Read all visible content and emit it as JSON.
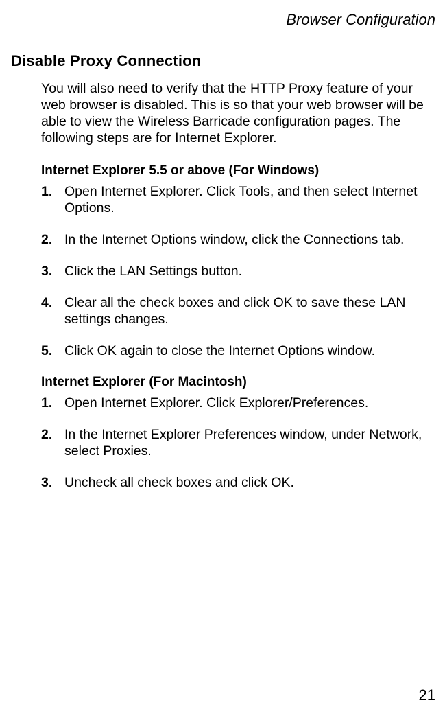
{
  "header": {
    "chapter": "Browser Configuration"
  },
  "section": {
    "heading": "Disable Proxy Connection",
    "intro": "You will also need to verify that the HTTP Proxy feature of your web browser is disabled. This is so that your web browser will be able to view the Wireless Barricade configuration pages. The following steps are for Internet Explorer."
  },
  "subsections": [
    {
      "heading": "Internet Explorer 5.5 or above (For Windows)",
      "steps": [
        {
          "num": "1.",
          "text": "Open Internet Explorer. Click Tools, and then select Internet Options."
        },
        {
          "num": "2.",
          "text": "In the Internet Options window, click the Connections tab."
        },
        {
          "num": "3.",
          "text": "Click the LAN Settings button."
        },
        {
          "num": "4.",
          "text": "Clear all the check boxes and click OK to save these LAN settings changes."
        },
        {
          "num": "5.",
          "text": "Click OK again to close the Internet Options window."
        }
      ]
    },
    {
      "heading": "Internet Explorer (For Macintosh)",
      "steps": [
        {
          "num": "1.",
          "text": "Open Internet Explorer. Click Explorer/Preferences."
        },
        {
          "num": "2.",
          "text": "In the Internet Explorer Preferences window, under Network, select Proxies."
        },
        {
          "num": "3.",
          "text": "Uncheck all check boxes and click OK."
        }
      ]
    }
  ],
  "page_number": "21"
}
